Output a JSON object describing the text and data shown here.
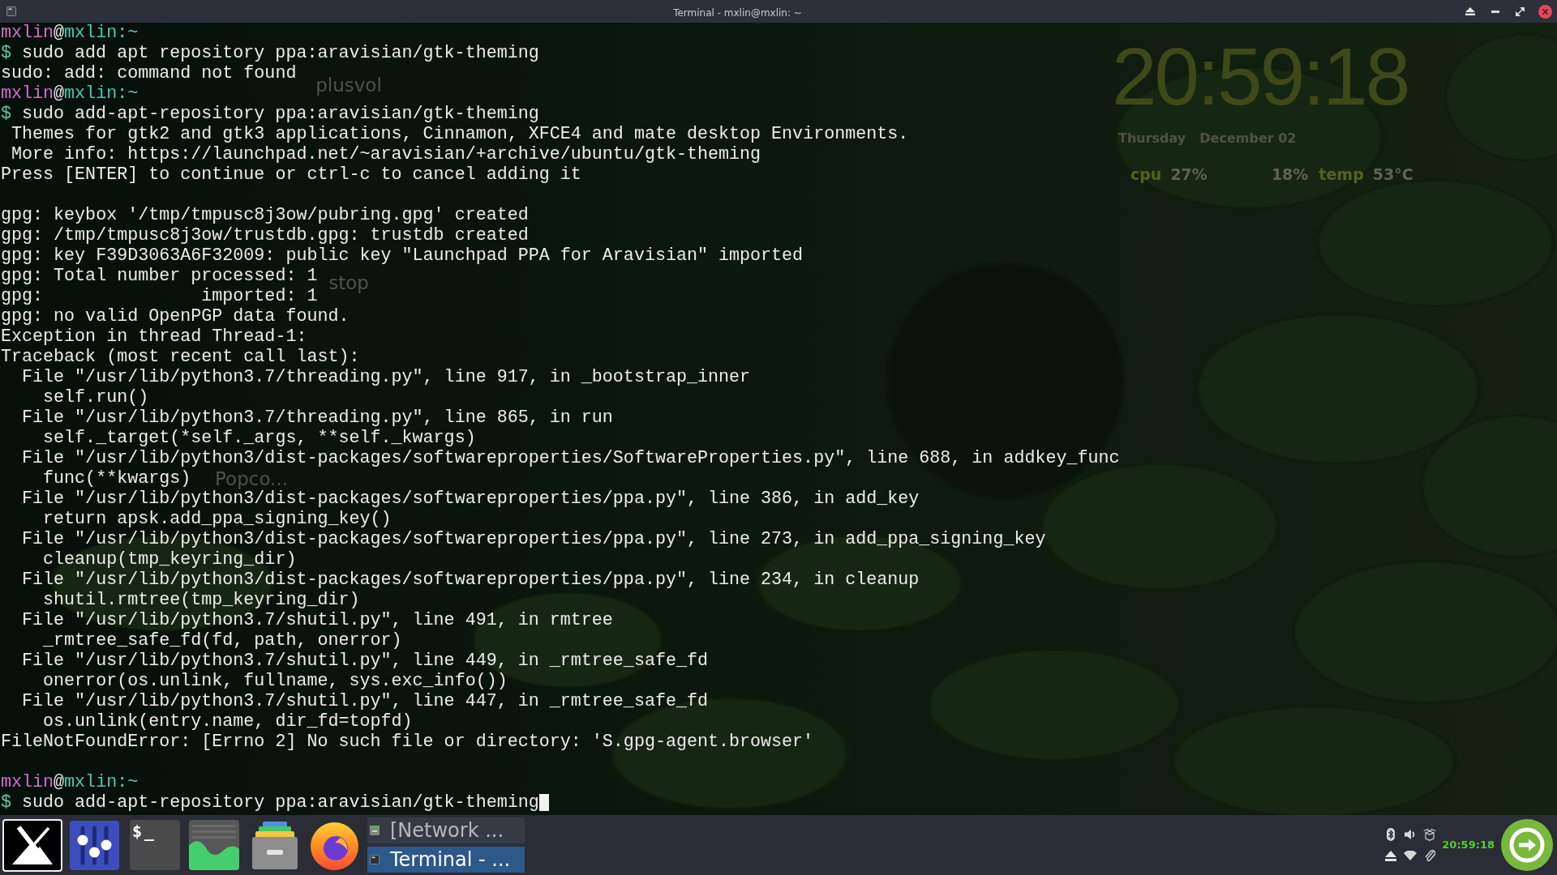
{
  "window": {
    "title": "Terminal - mxlin@mxlin: ~"
  },
  "terminal": {
    "lines": [
      {
        "kind": "prompt",
        "user": "mxlin",
        "at": "@",
        "host": "mxlin",
        "path": ":~"
      },
      {
        "kind": "command",
        "symbol": "$",
        "text": "sudo add apt repository ppa:aravisian/gtk-theming",
        "cursor": false
      },
      {
        "kind": "output",
        "text": "sudo: add: command not found"
      },
      {
        "kind": "prompt",
        "user": "mxlin",
        "at": "@",
        "host": "mxlin",
        "path": ":~"
      },
      {
        "kind": "command",
        "symbol": "$",
        "text": "sudo add-apt-repository ppa:aravisian/gtk-theming",
        "cursor": false
      },
      {
        "kind": "output",
        "text": " Themes for gtk2 and gtk3 applications, Cinnamon, XFCE4 and mate desktop Environments."
      },
      {
        "kind": "output",
        "text": " More info: https://launchpad.net/~aravisian/+archive/ubuntu/gtk-theming"
      },
      {
        "kind": "output",
        "text": "Press [ENTER] to continue or ctrl-c to cancel adding it"
      },
      {
        "kind": "blank"
      },
      {
        "kind": "output",
        "text": "gpg: keybox '/tmp/tmpusc8j3ow/pubring.gpg' created"
      },
      {
        "kind": "output",
        "text": "gpg: /tmp/tmpusc8j3ow/trustdb.gpg: trustdb created"
      },
      {
        "kind": "output",
        "text": "gpg: key F39D3063A6F32009: public key \"Launchpad PPA for Aravisian\" imported"
      },
      {
        "kind": "output",
        "text": "gpg: Total number processed: 1"
      },
      {
        "kind": "output",
        "text": "gpg:               imported: 1"
      },
      {
        "kind": "output",
        "text": "gpg: no valid OpenPGP data found."
      },
      {
        "kind": "output",
        "text": "Exception in thread Thread-1:"
      },
      {
        "kind": "output",
        "text": "Traceback (most recent call last):"
      },
      {
        "kind": "output",
        "text": "  File \"/usr/lib/python3.7/threading.py\", line 917, in _bootstrap_inner"
      },
      {
        "kind": "output",
        "text": "    self.run()"
      },
      {
        "kind": "output",
        "text": "  File \"/usr/lib/python3.7/threading.py\", line 865, in run"
      },
      {
        "kind": "output",
        "text": "    self._target(*self._args, **self._kwargs)"
      },
      {
        "kind": "output",
        "text": "  File \"/usr/lib/python3/dist-packages/softwareproperties/SoftwareProperties.py\", line 688, in addkey_func"
      },
      {
        "kind": "output",
        "text": "    func(**kwargs)"
      },
      {
        "kind": "output",
        "text": "  File \"/usr/lib/python3/dist-packages/softwareproperties/ppa.py\", line 386, in add_key"
      },
      {
        "kind": "output",
        "text": "    return apsk.add_ppa_signing_key()"
      },
      {
        "kind": "output",
        "text": "  File \"/usr/lib/python3/dist-packages/softwareproperties/ppa.py\", line 273, in add_ppa_signing_key"
      },
      {
        "kind": "output",
        "text": "    cleanup(tmp_keyring_dir)"
      },
      {
        "kind": "output",
        "text": "  File \"/usr/lib/python3/dist-packages/softwareproperties/ppa.py\", line 234, in cleanup"
      },
      {
        "kind": "output",
        "text": "    shutil.rmtree(tmp_keyring_dir)"
      },
      {
        "kind": "output",
        "text": "  File \"/usr/lib/python3.7/shutil.py\", line 491, in rmtree"
      },
      {
        "kind": "output",
        "text": "    _rmtree_safe_fd(fd, path, onerror)"
      },
      {
        "kind": "output",
        "text": "  File \"/usr/lib/python3.7/shutil.py\", line 449, in _rmtree_safe_fd"
      },
      {
        "kind": "output",
        "text": "    onerror(os.unlink, fullname, sys.exc_info())"
      },
      {
        "kind": "output",
        "text": "  File \"/usr/lib/python3.7/shutil.py\", line 447, in _rmtree_safe_fd"
      },
      {
        "kind": "output",
        "text": "    os.unlink(entry.name, dir_fd=topfd)"
      },
      {
        "kind": "output",
        "text": "FileNotFoundError: [Errno 2] No such file or directory: 'S.gpg-agent.browser'"
      },
      {
        "kind": "blank"
      },
      {
        "kind": "prompt",
        "user": "mxlin",
        "at": "@",
        "host": "mxlin",
        "path": ":~"
      },
      {
        "kind": "command",
        "symbol": "$",
        "text": "sudo add-apt-repository ppa:aravisian/gtk-theming",
        "cursor": true
      }
    ]
  },
  "desktop": {
    "icons": [
      {
        "label": "plusvol"
      },
      {
        "label": "stop"
      },
      {
        "label": "Popco..."
      }
    ],
    "conky": {
      "time": "20:59:18",
      "weekday": "Thursday",
      "date": "December 02",
      "stats": [
        {
          "label": "cpu",
          "value": "27%"
        },
        {
          "value": "18%"
        },
        {
          "label": "temp",
          "value": "53°C"
        }
      ]
    }
  },
  "taskbar": {
    "terminal_launcher": {
      "glyph": "$_"
    },
    "tasks": [
      {
        "kind": "files",
        "label": "[Network ...",
        "selected": false
      },
      {
        "kind": "terminal",
        "label": "Terminal - ...",
        "selected": true
      }
    ],
    "clock": "20:59:18"
  }
}
